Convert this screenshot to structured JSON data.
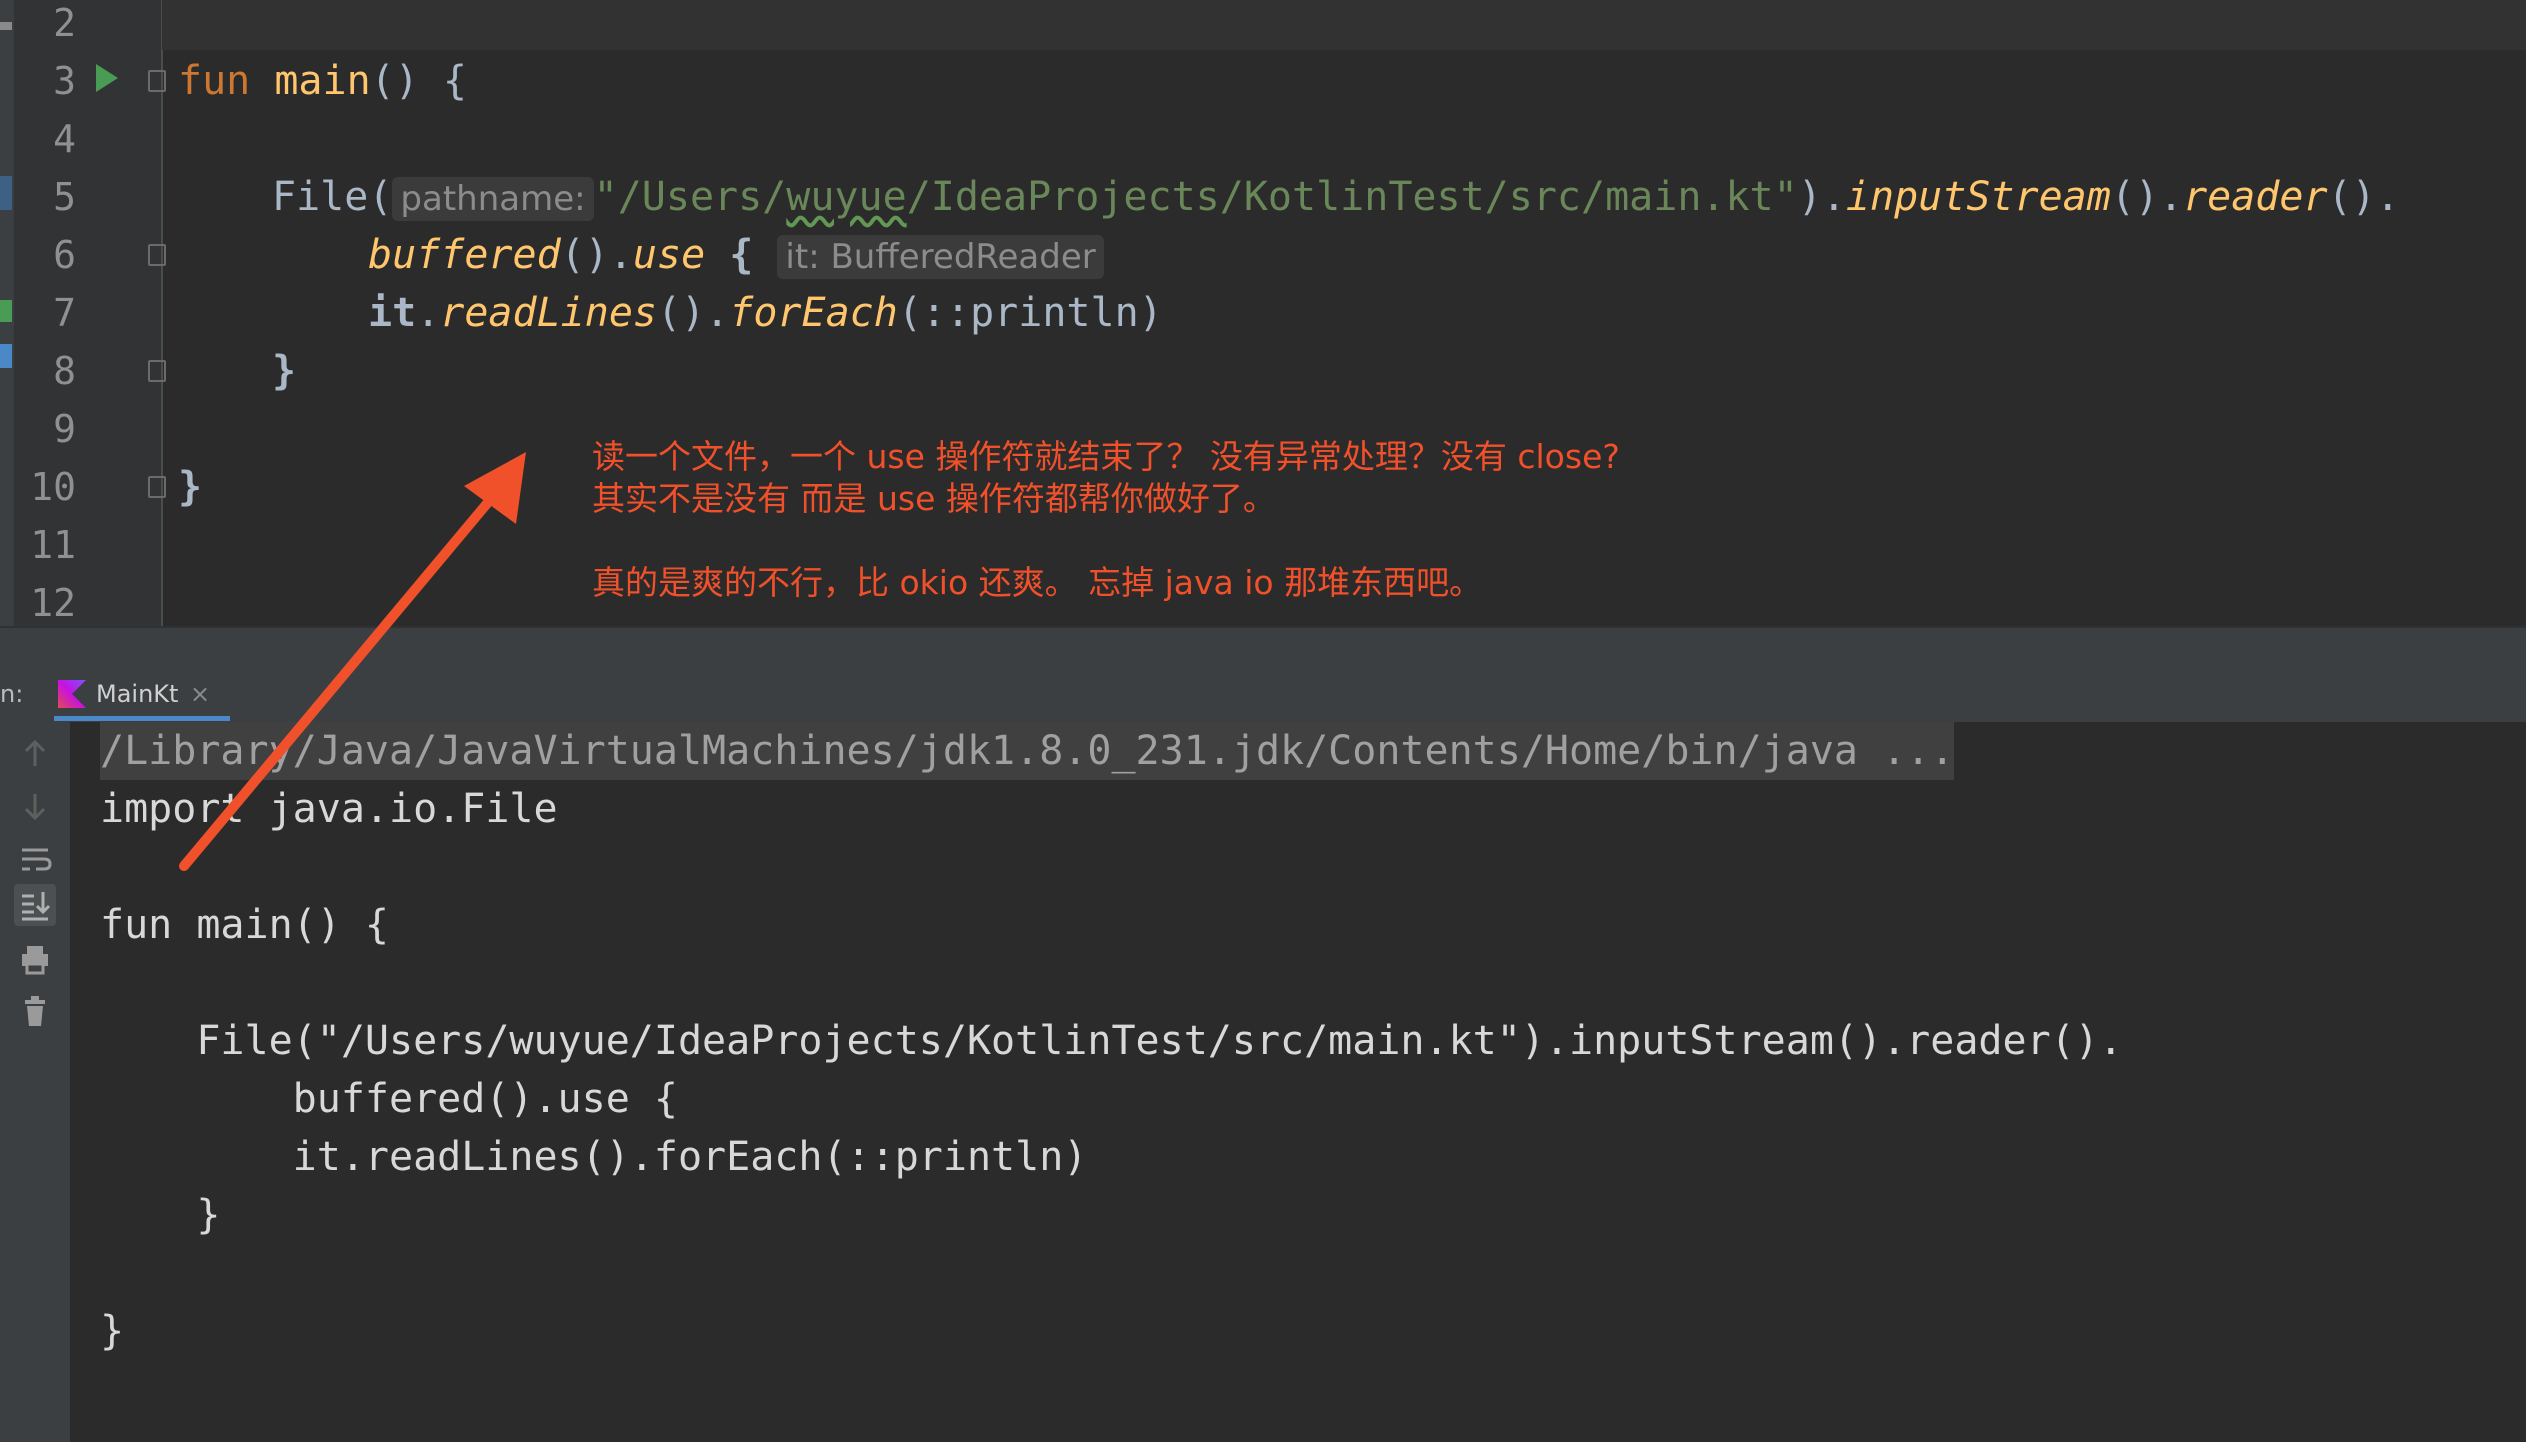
{
  "editor": {
    "line_numbers": [
      "2",
      "3",
      "4",
      "5",
      "6",
      "7",
      "8",
      "9",
      "10",
      "11",
      "12"
    ],
    "code": {
      "l3_fun": "fun",
      "l3_main": "main",
      "l3_rest": "() {",
      "l5_file": "File(",
      "l5_hint": "pathname:",
      "l5_str_a": "\"/Users/",
      "l5_str_typo": "wuyue",
      "l5_str_b": "/IdeaProjects/KotlinTest/src/main.kt\"",
      "l5_close": ").",
      "l5_input": "inputStream",
      "l5_paren": "().",
      "l5_reader": "reader",
      "l5_end": "().",
      "l6_buffered": "buffered",
      "l6_paren": "().",
      "l6_use": "use",
      "l6_brace": " {",
      "l6_hint": "it: BufferedReader",
      "l7_it": "it",
      "l7_dot": ".",
      "l7_readlines": "readLines",
      "l7_paren": "().",
      "l7_foreach": "forEach",
      "l7_rest": "(::println)",
      "l8": "}",
      "l10": "}"
    }
  },
  "annotation": {
    "line1": "读一个文件，一个 use 操作符就结束了？ 没有异常处理？没有 close?",
    "line2": "其实不是没有 而是 use 操作符都帮你做好了。",
    "line3": "真的是爽的不行，比 okio 还爽。 忘掉 java io 那堆东西吧。"
  },
  "run_panel": {
    "label": "n:",
    "tab_label": "MainKt",
    "tab_close": "×"
  },
  "console": {
    "lines": [
      "/Library/Java/JavaVirtualMachines/jdk1.8.0_231.jdk/Contents/Home/bin/java ...",
      "import java.io.File",
      "fun main() {",
      "    File(\"/Users/wuyue/IdeaProjects/KotlinTest/src/main.kt\").inputStream().reader().",
      "        buffered().use {",
      "        it.readLines().forEach(::println)",
      "    }",
      "}"
    ]
  },
  "colors": {
    "annotation": "#f0502a",
    "keyword": "#cc7832",
    "function": "#ffc66d",
    "string": "#6a8759"
  }
}
